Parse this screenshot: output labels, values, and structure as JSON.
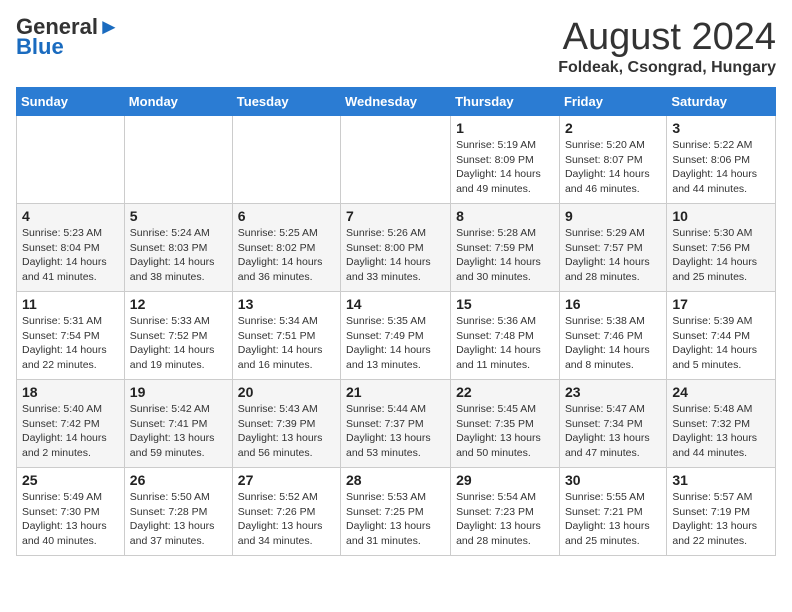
{
  "header": {
    "logo_general": "General",
    "logo_blue": "Blue",
    "title": "August 2024",
    "location": "Foldeak, Csongrad, Hungary"
  },
  "weekdays": [
    "Sunday",
    "Monday",
    "Tuesday",
    "Wednesday",
    "Thursday",
    "Friday",
    "Saturday"
  ],
  "weeks": [
    [
      {
        "day": "",
        "info": ""
      },
      {
        "day": "",
        "info": ""
      },
      {
        "day": "",
        "info": ""
      },
      {
        "day": "",
        "info": ""
      },
      {
        "day": "1",
        "info": "Sunrise: 5:19 AM\nSunset: 8:09 PM\nDaylight: 14 hours and 49 minutes."
      },
      {
        "day": "2",
        "info": "Sunrise: 5:20 AM\nSunset: 8:07 PM\nDaylight: 14 hours and 46 minutes."
      },
      {
        "day": "3",
        "info": "Sunrise: 5:22 AM\nSunset: 8:06 PM\nDaylight: 14 hours and 44 minutes."
      }
    ],
    [
      {
        "day": "4",
        "info": "Sunrise: 5:23 AM\nSunset: 8:04 PM\nDaylight: 14 hours and 41 minutes."
      },
      {
        "day": "5",
        "info": "Sunrise: 5:24 AM\nSunset: 8:03 PM\nDaylight: 14 hours and 38 minutes."
      },
      {
        "day": "6",
        "info": "Sunrise: 5:25 AM\nSunset: 8:02 PM\nDaylight: 14 hours and 36 minutes."
      },
      {
        "day": "7",
        "info": "Sunrise: 5:26 AM\nSunset: 8:00 PM\nDaylight: 14 hours and 33 minutes."
      },
      {
        "day": "8",
        "info": "Sunrise: 5:28 AM\nSunset: 7:59 PM\nDaylight: 14 hours and 30 minutes."
      },
      {
        "day": "9",
        "info": "Sunrise: 5:29 AM\nSunset: 7:57 PM\nDaylight: 14 hours and 28 minutes."
      },
      {
        "day": "10",
        "info": "Sunrise: 5:30 AM\nSunset: 7:56 PM\nDaylight: 14 hours and 25 minutes."
      }
    ],
    [
      {
        "day": "11",
        "info": "Sunrise: 5:31 AM\nSunset: 7:54 PM\nDaylight: 14 hours and 22 minutes."
      },
      {
        "day": "12",
        "info": "Sunrise: 5:33 AM\nSunset: 7:52 PM\nDaylight: 14 hours and 19 minutes."
      },
      {
        "day": "13",
        "info": "Sunrise: 5:34 AM\nSunset: 7:51 PM\nDaylight: 14 hours and 16 minutes."
      },
      {
        "day": "14",
        "info": "Sunrise: 5:35 AM\nSunset: 7:49 PM\nDaylight: 14 hours and 13 minutes."
      },
      {
        "day": "15",
        "info": "Sunrise: 5:36 AM\nSunset: 7:48 PM\nDaylight: 14 hours and 11 minutes."
      },
      {
        "day": "16",
        "info": "Sunrise: 5:38 AM\nSunset: 7:46 PM\nDaylight: 14 hours and 8 minutes."
      },
      {
        "day": "17",
        "info": "Sunrise: 5:39 AM\nSunset: 7:44 PM\nDaylight: 14 hours and 5 minutes."
      }
    ],
    [
      {
        "day": "18",
        "info": "Sunrise: 5:40 AM\nSunset: 7:42 PM\nDaylight: 14 hours and 2 minutes."
      },
      {
        "day": "19",
        "info": "Sunrise: 5:42 AM\nSunset: 7:41 PM\nDaylight: 13 hours and 59 minutes."
      },
      {
        "day": "20",
        "info": "Sunrise: 5:43 AM\nSunset: 7:39 PM\nDaylight: 13 hours and 56 minutes."
      },
      {
        "day": "21",
        "info": "Sunrise: 5:44 AM\nSunset: 7:37 PM\nDaylight: 13 hours and 53 minutes."
      },
      {
        "day": "22",
        "info": "Sunrise: 5:45 AM\nSunset: 7:35 PM\nDaylight: 13 hours and 50 minutes."
      },
      {
        "day": "23",
        "info": "Sunrise: 5:47 AM\nSunset: 7:34 PM\nDaylight: 13 hours and 47 minutes."
      },
      {
        "day": "24",
        "info": "Sunrise: 5:48 AM\nSunset: 7:32 PM\nDaylight: 13 hours and 44 minutes."
      }
    ],
    [
      {
        "day": "25",
        "info": "Sunrise: 5:49 AM\nSunset: 7:30 PM\nDaylight: 13 hours and 40 minutes."
      },
      {
        "day": "26",
        "info": "Sunrise: 5:50 AM\nSunset: 7:28 PM\nDaylight: 13 hours and 37 minutes."
      },
      {
        "day": "27",
        "info": "Sunrise: 5:52 AM\nSunset: 7:26 PM\nDaylight: 13 hours and 34 minutes."
      },
      {
        "day": "28",
        "info": "Sunrise: 5:53 AM\nSunset: 7:25 PM\nDaylight: 13 hours and 31 minutes."
      },
      {
        "day": "29",
        "info": "Sunrise: 5:54 AM\nSunset: 7:23 PM\nDaylight: 13 hours and 28 minutes."
      },
      {
        "day": "30",
        "info": "Sunrise: 5:55 AM\nSunset: 7:21 PM\nDaylight: 13 hours and 25 minutes."
      },
      {
        "day": "31",
        "info": "Sunrise: 5:57 AM\nSunset: 7:19 PM\nDaylight: 13 hours and 22 minutes."
      }
    ]
  ]
}
